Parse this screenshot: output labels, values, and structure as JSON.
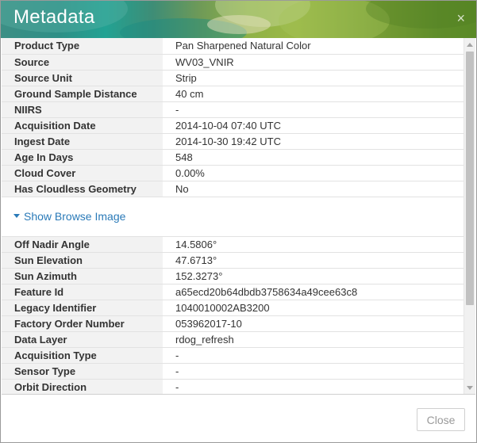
{
  "dialog": {
    "title": "Metadata",
    "close_icon": "×",
    "close_button_label": "Close"
  },
  "rows_top": [
    {
      "key": "Product Type",
      "value": "Pan Sharpened Natural Color"
    },
    {
      "key": "Source",
      "value": "WV03_VNIR"
    },
    {
      "key": "Source Unit",
      "value": "Strip"
    },
    {
      "key": "Ground Sample Distance",
      "value": "40 cm"
    },
    {
      "key": "NIIRS",
      "value": "-"
    },
    {
      "key": "Acquisition Date",
      "value": "2014-10-04 07:40 UTC"
    },
    {
      "key": "Ingest Date",
      "value": "2014-10-30 19:42 UTC"
    },
    {
      "key": "Age In Days",
      "value": "548"
    },
    {
      "key": "Cloud Cover",
      "value": "0.00%"
    },
    {
      "key": "Has Cloudless Geometry",
      "value": "No"
    }
  ],
  "browse_link_label": "Show Browse Image",
  "rows_bottom": [
    {
      "key": "Off Nadir Angle",
      "value": "14.5806°"
    },
    {
      "key": "Sun Elevation",
      "value": "47.6713°"
    },
    {
      "key": "Sun Azimuth",
      "value": "152.3273°"
    },
    {
      "key": "Feature Id",
      "value": "a65ecd20b64dbdb3758634a49cee63c8"
    },
    {
      "key": "Legacy Identifier",
      "value": "1040010002AB3200"
    },
    {
      "key": "Factory Order Number",
      "value": "053962017-10"
    },
    {
      "key": "Data Layer",
      "value": "rdog_refresh"
    },
    {
      "key": "Acquisition Type",
      "value": "-"
    },
    {
      "key": "Sensor Type",
      "value": "-"
    },
    {
      "key": "Orbit Direction",
      "value": "-"
    }
  ],
  "icons": {
    "close": "close-icon",
    "caret": "caret-down-icon",
    "scroll_up": "scroll-up-arrow-icon",
    "scroll_down": "scroll-down-arrow-icon"
  },
  "colors": {
    "link": "#2a7ab8",
    "key_background": "#f2f2f2",
    "header_teal": "#22a293",
    "header_green": "#8fb247"
  }
}
